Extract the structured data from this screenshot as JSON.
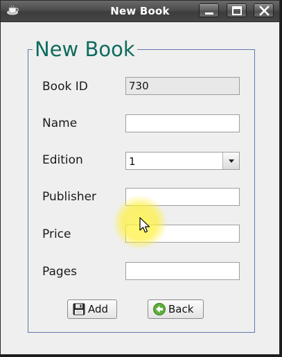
{
  "window": {
    "title": "New Book",
    "icon": "coffee-cup-icon",
    "controls": {
      "minimize": "minimize-icon",
      "maximize": "maximize-icon",
      "close": "close-icon"
    }
  },
  "form": {
    "group_title": "New Book",
    "fields": {
      "book_id": {
        "label": "Book ID",
        "value": "730"
      },
      "name": {
        "label": "Name",
        "value": ""
      },
      "edition": {
        "label": "Edition",
        "value": "1"
      },
      "publisher": {
        "label": "Publisher",
        "value": ""
      },
      "price": {
        "label": "Price",
        "value": ""
      },
      "pages": {
        "label": "Pages",
        "value": ""
      }
    },
    "buttons": {
      "add": {
        "label": "Add",
        "icon": "floppy-disk-icon"
      },
      "back": {
        "label": "Back",
        "icon": "back-arrow-icon"
      }
    }
  },
  "colors": {
    "group_title": "#0e6b5e",
    "group_border": "#5f76a8",
    "cursor_highlight": "#fff03c"
  }
}
